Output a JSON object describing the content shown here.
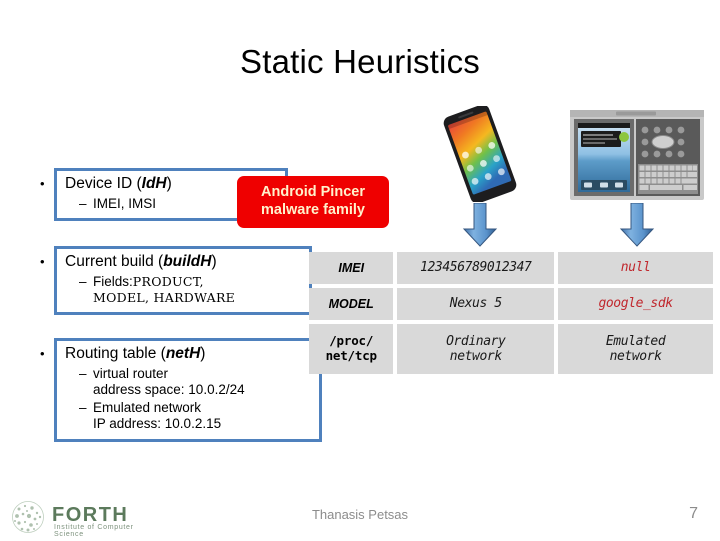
{
  "slide": {
    "title": "Static Heuristics",
    "page_number": "7"
  },
  "bullets": [
    {
      "dot": "•",
      "heading_prefix": "Device ID (",
      "heading_emphasis": "IdH",
      "heading_suffix": ")",
      "sub_dash": "–",
      "sub_text": "IMEI, IMSI"
    },
    {
      "dot": "•",
      "heading_prefix": "Current build (",
      "heading_emphasis": "buildH",
      "heading_suffix": ")",
      "sub_dash": "–",
      "sub_label": "Fields:",
      "sub_fields_line1": "PRODUCT,",
      "sub_fields_line2": "MODEL, HARDWARE"
    },
    {
      "dot": "•",
      "heading_prefix": "Routing table (",
      "heading_emphasis": "netH",
      "heading_suffix": ")",
      "sub_dash_1": "–",
      "sub_1_line1": "virtual router",
      "sub_1_line2": "address space: 10.0.2/24",
      "sub_dash_2": "–",
      "sub_2_line1": "Emulated network",
      "sub_2_line2": "IP address: 10.0.2.15"
    }
  ],
  "malware_callout": {
    "line1": "Android Pincer",
    "line2": "malware family",
    "background_color": "#EF0000",
    "text_color": "#FFF2CC"
  },
  "devices": {
    "left": {
      "icon_name": "android-phone-nexus5",
      "arrow_icon": "down-arrow"
    },
    "right": {
      "icon_name": "android-emulator-window",
      "arrow_icon": "down-arrow"
    },
    "arrow_color": "#4a7ebb"
  },
  "comparison_table": {
    "rows": [
      {
        "label": "IMEI",
        "label_style": "sans",
        "real_value": "123456789012347",
        "emulator_value": "null",
        "emulator_value_color": "#C0272D"
      },
      {
        "label": "MODEL",
        "label_style": "sans",
        "real_value": "Nexus 5",
        "emulator_value": "google_sdk",
        "emulator_value_color": "#C0272D"
      },
      {
        "label_line1": "/proc/",
        "label_line2": "net/tcp",
        "label_style": "mono",
        "real_value_line1": "Ordinary",
        "real_value_line2": "network",
        "emulator_value_line1": "Emulated",
        "emulator_value_line2": "network",
        "emulator_value_color": "#1A1A1A"
      }
    ],
    "cell_background": "#D9D9D9"
  },
  "footer": {
    "author": "Thanasis Petsas",
    "logo_wordmark": "FORTH",
    "logo_subtitle": "Institute of Computer Science"
  },
  "theme": {
    "callout_border": "#4F81BD",
    "footer_text": "#8C8C8C"
  }
}
